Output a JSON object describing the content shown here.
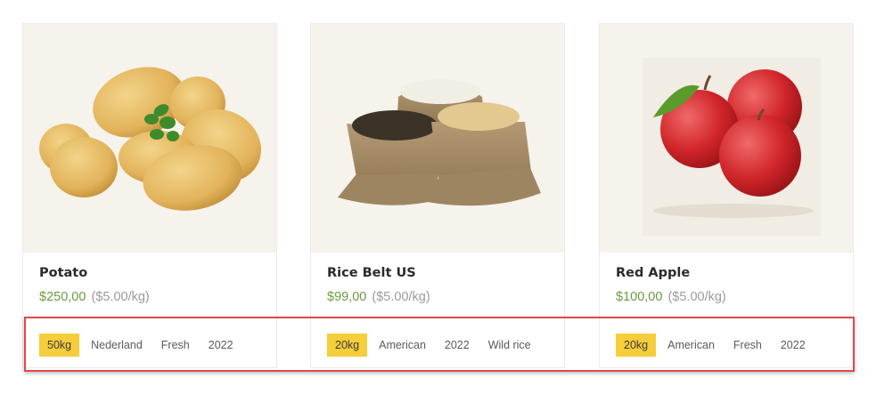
{
  "products": [
    {
      "name": "Potato",
      "price": "$250,00",
      "unit_price": "($5.00/kg)",
      "tags": [
        "50kg",
        "Nederland",
        "Fresh",
        "2022"
      ],
      "image_icon": "potato-image"
    },
    {
      "name": "Rice Belt US",
      "price": "$99,00",
      "unit_price": "($5.00/kg)",
      "tags": [
        "20kg",
        "American",
        "2022",
        "Wild rice"
      ],
      "image_icon": "rice-sacks-image"
    },
    {
      "name": "Red Apple",
      "price": "$100,00",
      "unit_price": "($5.00/kg)",
      "tags": [
        "20kg",
        "American",
        "Fresh",
        "2022"
      ],
      "image_icon": "red-apple-image"
    }
  ],
  "colors": {
    "price_green": "#6b9a3f",
    "tag_highlight": "#f6cd3a",
    "image_background": "#f6f3ec",
    "annotation_red": "#e0484d"
  }
}
